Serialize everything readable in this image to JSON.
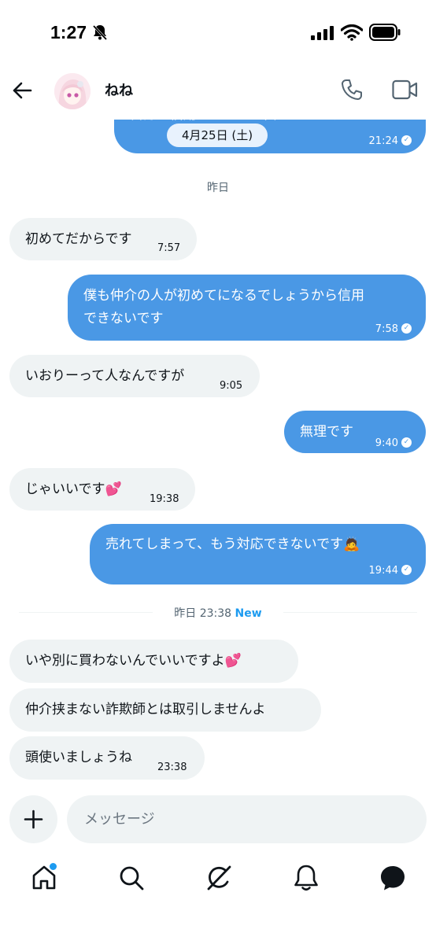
{
  "status_bar": {
    "time": "1:27"
  },
  "header": {
    "contact_name": "ねね"
  },
  "top_partial_message": {
    "text": "自分を信用できない理由はなんですか？",
    "time": "21:24"
  },
  "date_chip": "4月25日 (土)",
  "sep_yesterday": "昨日",
  "messages": [
    {
      "dir": "in",
      "text": "初めてだからです",
      "time": "7:57"
    },
    {
      "dir": "out",
      "line1": "僕も仲介の人が初めてになるでしょうから信用",
      "line2": "できないです",
      "time": "7:58"
    },
    {
      "dir": "in",
      "text": "いおりーって人なんですが",
      "time": "9:05"
    },
    {
      "dir": "out",
      "text": "無理です",
      "time": "9:40"
    },
    {
      "dir": "in",
      "text": "じゃいいです💕",
      "time": "19:38"
    },
    {
      "dir": "out",
      "text": "売れてしまって、もう対応できないです🙇",
      "time": "19:44"
    }
  ],
  "new_divider": {
    "label": "昨日 23:38",
    "new_label": "New"
  },
  "new_messages": [
    {
      "dir": "in",
      "text": "いや別に買わないんでいいですよ💕"
    },
    {
      "dir": "in",
      "text": "仲介挟まない詐欺師とは取引しませんよ"
    },
    {
      "dir": "in",
      "text": "頭使いましょうね",
      "time": "23:38"
    }
  ],
  "composer": {
    "placeholder": "メッセージ"
  },
  "colors": {
    "accent": "#1d9bf0",
    "outgoing_bubble": "#4a98e5",
    "incoming_bubble": "#eff3f4"
  },
  "icons": [
    "back-arrow-icon",
    "phone-icon",
    "video-icon",
    "plus-icon",
    "home-icon",
    "search-icon",
    "grok-icon",
    "bell-icon",
    "messages-icon"
  ]
}
